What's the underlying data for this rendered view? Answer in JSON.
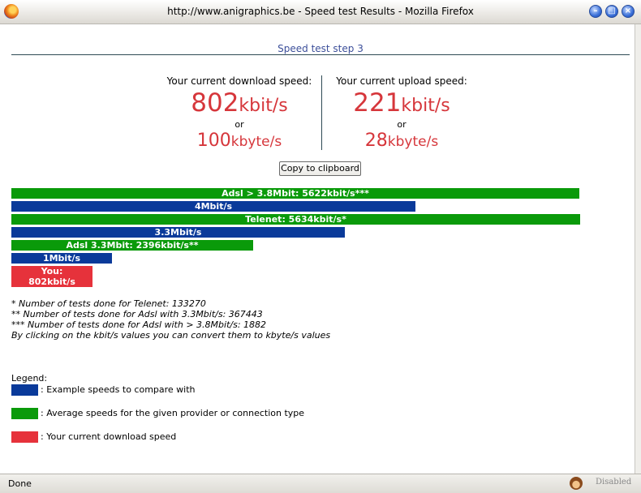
{
  "window": {
    "title": "http://www.anigraphics.be - Speed test Results - Mozilla Firefox",
    "buttons": {
      "minimize": "–",
      "maximize": "□",
      "close": "×"
    }
  },
  "page": {
    "step_title": "Speed test step 3",
    "download": {
      "label": "Your current download speed:",
      "kbit_value": "802",
      "kbit_unit": "kbit/s",
      "or": "or",
      "kbyte_value": "100",
      "kbyte_unit": "kbyte/s"
    },
    "upload": {
      "label": "Your current upload speed:",
      "kbit_value": "221",
      "kbit_unit": "kbit/s",
      "or": "or",
      "kbyte_value": "28",
      "kbyte_unit": "kbyte/s"
    },
    "copy_button": "Copy to clipboard",
    "notes": [
      "* Number of tests done for Telenet: 133270",
      "** Number of tests done for Adsl with 3.3Mbit/s: 367443",
      "*** Number of tests done for Adsl with > 3.8Mbit/s: 1882",
      "By clicking on the kbit/s values you can convert them to kbyte/s values"
    ],
    "legend": {
      "title": "Legend:",
      "items": [
        {
          "color": "#0a3a9a",
          "text": ": Example speeds to compare with"
        },
        {
          "color": "#0a9a0a",
          "text": ": Average speeds for the given provider or connection type"
        },
        {
          "color": "#e6323b",
          "text": ": Your current download speed"
        }
      ]
    }
  },
  "chart_data": {
    "type": "bar",
    "orientation": "horizontal",
    "unit": "kbit/s",
    "bars": [
      {
        "label": "Adsl > 3.8Mbit: 5622kbit/s***",
        "value": 5622,
        "kind": "average",
        "color": "#0a9a0a"
      },
      {
        "label": "4Mbit/s",
        "value": 4000,
        "kind": "example",
        "color": "#0a3a9a"
      },
      {
        "label": "Telenet: 5634kbit/s*",
        "value": 5634,
        "kind": "average",
        "color": "#0a9a0a"
      },
      {
        "label": "3.3Mbit/s",
        "value": 3300,
        "kind": "example",
        "color": "#0a3a9a"
      },
      {
        "label": "Adsl 3.3Mbit: 2396kbit/s**",
        "value": 2396,
        "kind": "average",
        "color": "#0a9a0a"
      },
      {
        "label": "1Mbit/s",
        "value": 1000,
        "kind": "example",
        "color": "#0a3a9a"
      },
      {
        "label": "You: 802kbit/s",
        "value": 802,
        "kind": "you",
        "color": "#e6323b"
      }
    ]
  },
  "statusbar": {
    "left": "Done",
    "right": "Disabled"
  }
}
